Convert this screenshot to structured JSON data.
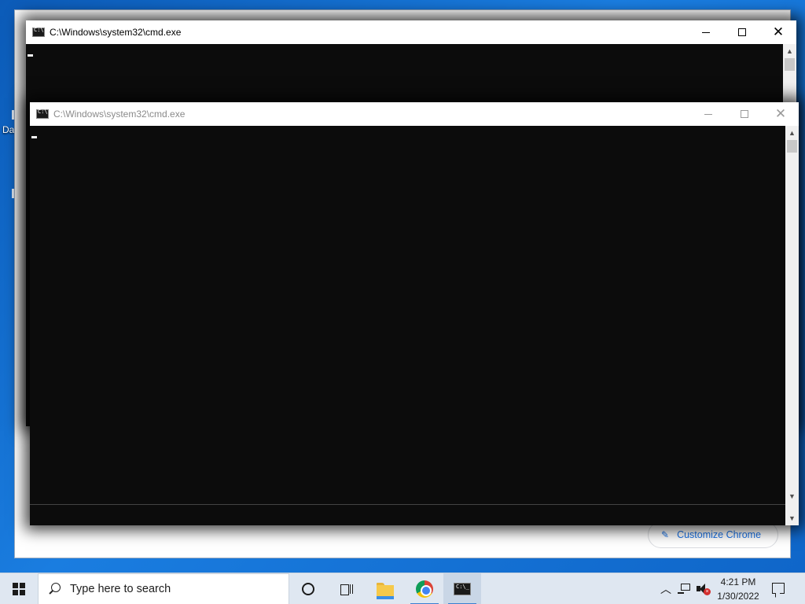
{
  "desktop": {
    "icon_label_fragment": "Da"
  },
  "chrome_background": {
    "customize_label": "Customize Chrome",
    "customize_icon": "pencil-icon"
  },
  "cmd_back": {
    "title": "C:\\Windows\\system32\\cmd.exe",
    "state": "active"
  },
  "cmd_front": {
    "title": "C:\\Windows\\system32\\cmd.exe",
    "state": "inactive"
  },
  "taskbar": {
    "search_placeholder": "Type here to search",
    "pinned": [
      "cortana-icon",
      "task-view-icon",
      "file-explorer-icon",
      "chrome-icon",
      "cmd-icon"
    ],
    "time": "4:21 PM",
    "date": "1/30/2022",
    "accent": "#3a7fd0"
  }
}
